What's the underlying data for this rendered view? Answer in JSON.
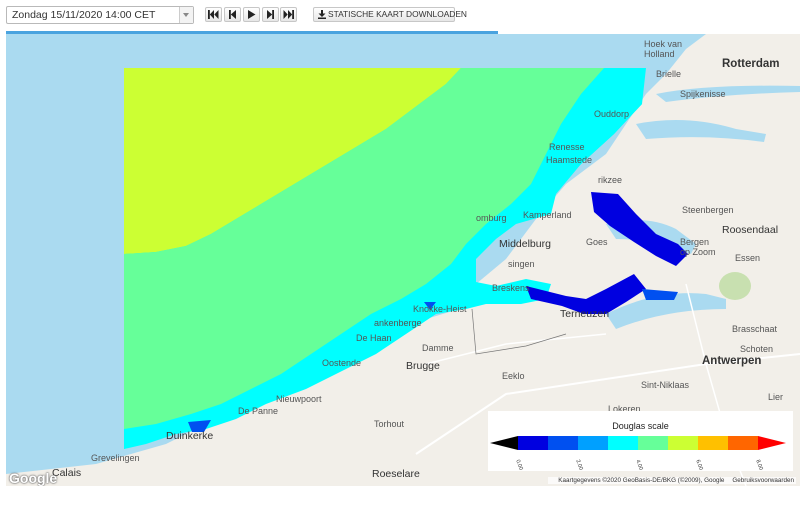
{
  "toolbar": {
    "date_value": "Zondag 15/11/2020 14:00 CET",
    "buttons": [
      "first-frame",
      "previous-frame",
      "play",
      "next-frame",
      "last-frame"
    ],
    "download_label": "STATISCHE KAART DOWNLOADEN"
  },
  "progress_fraction": 0.62,
  "map": {
    "places": {
      "rotterdam": "Rotterdam",
      "hoek": "Hoek van\nHolland",
      "brielle": "Brielle",
      "spijkenisse": "Spijkenisse",
      "ouddorp": "Ouddorp",
      "renesse": "Renesse",
      "haamstede": "Haamstede",
      "zierikzee": "rikzee",
      "steenbergen": "Steenbergen",
      "roosendaal": "Roosendaal",
      "domburg": "omburg",
      "kamperland": "Kamperland",
      "middelburg": "Middelburg",
      "goes": "Goes",
      "bergen": "Bergen\nop Zoom",
      "essen": "Essen",
      "vlissingen": "singen",
      "breskens": "Breskens",
      "terneuzen": "Terneuzen",
      "knokke": "Knokke-Heist",
      "blankenberge": "ankenberge",
      "dehaan": "De Haan",
      "damme": "Damme",
      "oostende": "Oostende",
      "brugge": "Brugge",
      "eeklo": "Eeklo",
      "brasschaat": "Brasschaat",
      "schoten": "Schoten",
      "antwerpen": "Antwerpen",
      "sintniklaas": "Sint-Niklaas",
      "lier": "Lier",
      "lokeren": "Lokeren",
      "nieuwpoort": "Nieuwpoort",
      "depanne": "De Panne",
      "duinkerke": "Duinkerke",
      "torhout": "Torhout",
      "gravelines": "Grevelingen",
      "calais": "Calais",
      "roeselare": "Roeselare"
    },
    "legend": {
      "title": "Douglas scale",
      "ticks": [
        "0.00",
        "2.00",
        "4.00",
        "6.00",
        "8.00"
      ],
      "colors": [
        "#000000",
        "#0000e0",
        "#0050f0",
        "#00a0ff",
        "#00ffff",
        "#66ff99",
        "#ccff33",
        "#ffc000",
        "#ff6600",
        "#ff0000"
      ]
    },
    "attribution": "Kaartgegevens ©2020 GeoBasis-DE/BKG (©2009), Google",
    "terms": "Gebruiksvoorwaarden",
    "google_logo": "Google"
  }
}
